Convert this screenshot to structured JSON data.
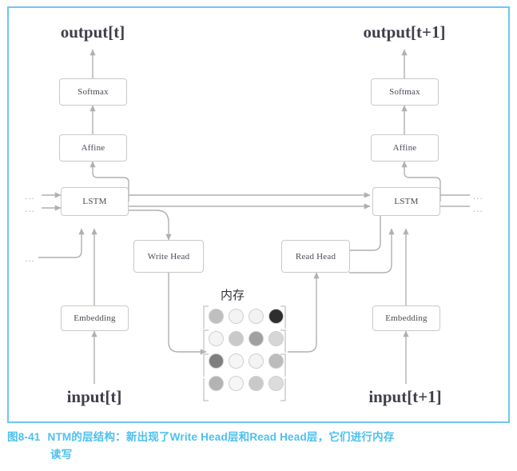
{
  "figure": {
    "frame_color": "#6dc8f1",
    "caption_color": "#4cc0ef",
    "caption_number": "图8-41",
    "caption_line1": "NTM的层结构：新出现了Write Head层和Read Head层，它们进行内存",
    "caption_line2": "读写"
  },
  "diagram": {
    "timestep_left": {
      "output_label": "output[t]",
      "input_label": "input[t]",
      "softmax": "Softmax",
      "affine": "Affine",
      "lstm": "LSTM",
      "embedding": "Embedding",
      "head": "Write Head"
    },
    "timestep_right": {
      "output_label": "output[t+1]",
      "input_label": "input[t+1]",
      "softmax": "Softmax",
      "affine": "Affine",
      "lstm": "LSTM",
      "embedding": "Embedding",
      "head": "Read Head"
    },
    "memory": {
      "title": "内存",
      "rows": 4,
      "cols": 4,
      "cell_colors": [
        [
          "#bfbfbf",
          "#f3f3f3",
          "#f2f2f2",
          "#2e2e2e"
        ],
        [
          "#f4f4f4",
          "#c9c9c9",
          "#a0a0a0",
          "#d6d6d6"
        ],
        [
          "#7e7e7e",
          "#f6f6f6",
          "#f3f3f3",
          "#bcbcbc"
        ],
        [
          "#b3b3b3",
          "#f6f6f6",
          "#c9c9c9",
          "#dcdcdc"
        ]
      ]
    },
    "ellipsis": {
      "left_upper": "...",
      "left_lower": "...",
      "left_bottom": "...",
      "right_upper": "...",
      "right_lower": "..."
    },
    "wire_color": "#b0b0b0"
  }
}
